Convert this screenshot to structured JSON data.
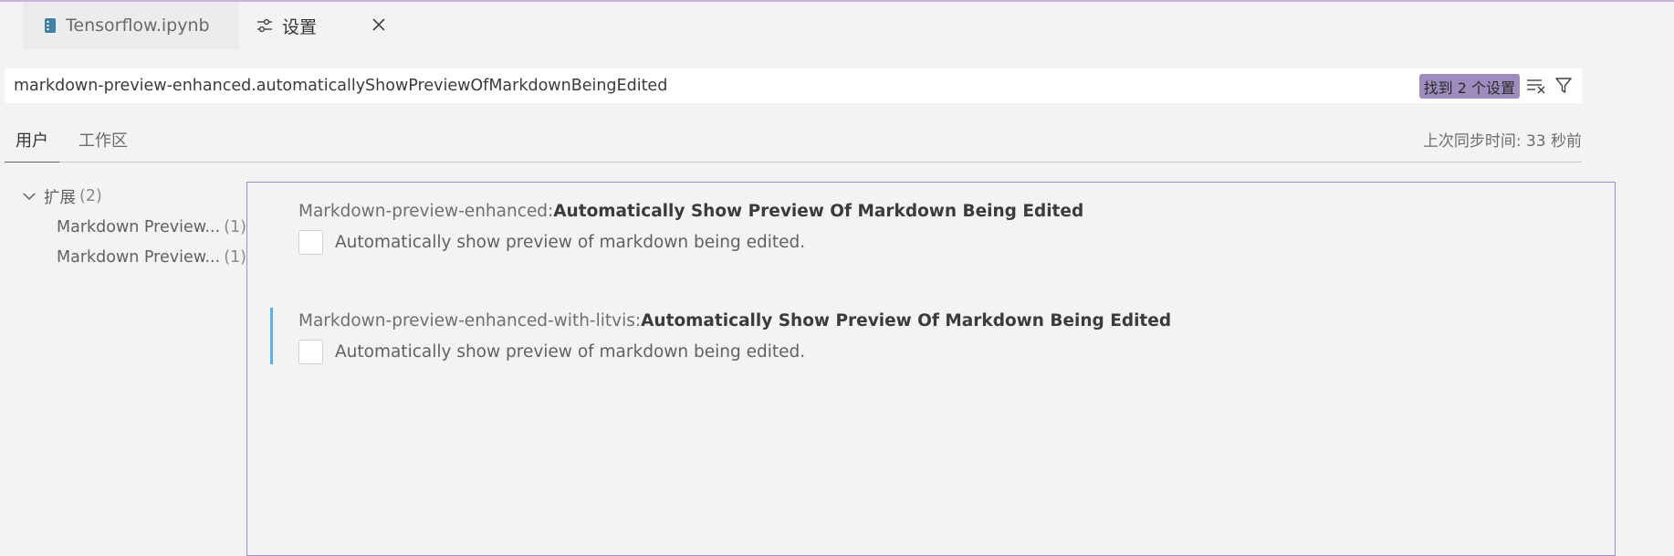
{
  "tabs": [
    {
      "label": "Tensorflow.ipynb",
      "icon": "notebook-icon"
    },
    {
      "label": "设置",
      "icon": "settings-sliders-icon"
    }
  ],
  "search": {
    "value": "markdown-preview-enhanced.automaticallyShowPreviewOfMarkdownBeingEdited",
    "result_badge": "找到 2 个设置"
  },
  "scope": {
    "user": "用户",
    "workspace": "工作区",
    "sync_status": "上次同步时间: 33 秒前"
  },
  "tree": {
    "group_label": "扩展",
    "group_count": "(2)",
    "items": [
      {
        "label": "Markdown Preview...",
        "count": "(1)"
      },
      {
        "label": "Markdown Preview...",
        "count": "(1)"
      }
    ]
  },
  "settings": [
    {
      "category": "Markdown-preview-enhanced: ",
      "name": "Automatically Show Preview Of Markdown Being Edited",
      "description": "Automatically show preview of markdown being edited."
    },
    {
      "category": "Markdown-preview-enhanced-with-litvis: ",
      "name": "Automatically Show Preview Of Markdown Being Edited",
      "description": "Automatically show preview of markdown being edited."
    }
  ],
  "colors": {
    "accent": "#a48ad4",
    "badge": "#9e8cbf",
    "focus_bar": "#67aee2",
    "notebook_icon": "#3f7fa8"
  }
}
